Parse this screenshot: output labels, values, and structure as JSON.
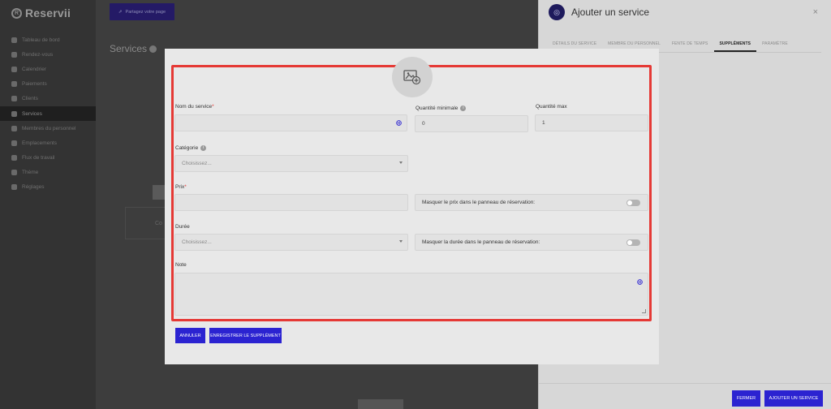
{
  "app": {
    "brand": "Reservii"
  },
  "sidebar": {
    "items": [
      {
        "label": "Tableau de bord",
        "icon": "dashboard-icon"
      },
      {
        "label": "Rendez-vous",
        "icon": "calendar-check-icon"
      },
      {
        "label": "Calendrier",
        "icon": "calendar-icon"
      },
      {
        "label": "Paiements",
        "icon": "payment-icon"
      },
      {
        "label": "Clients",
        "icon": "users-icon"
      },
      {
        "label": "Services",
        "icon": "services-icon",
        "active": true
      },
      {
        "label": "Membres du personnel",
        "icon": "staff-icon"
      },
      {
        "label": "Emplacements",
        "icon": "location-icon"
      },
      {
        "label": "Flux de travail",
        "icon": "workflow-icon"
      },
      {
        "label": "Thème",
        "icon": "brush-icon"
      },
      {
        "label": "Réglages",
        "icon": "gear-icon"
      }
    ]
  },
  "main": {
    "share_label": "Partagez votre page",
    "page_title": "Services",
    "ghost_card": "Co"
  },
  "drawer": {
    "title": "Ajouter un service",
    "close_glyph": "×",
    "tabs": [
      {
        "label": "DÉTAILS DU SERVICE"
      },
      {
        "label": "MEMBRE DU PERSONNEL"
      },
      {
        "label": "FENTE DE TEMPS"
      },
      {
        "label": "SUPPLÉMENTS",
        "active": true
      },
      {
        "label": "PARAMÈTRE"
      }
    ],
    "footer": {
      "close_label": "FERMER",
      "add_label": "AJOUTER UN SERVICE"
    }
  },
  "modal": {
    "image_upload_icon": "image-add-icon",
    "service_name": {
      "label": "Nom du service",
      "required_mark": "*",
      "value": ""
    },
    "min_qty": {
      "label": "Quantité minimale",
      "value": "0"
    },
    "max_qty": {
      "label": "Quantité max",
      "value": "1"
    },
    "category": {
      "label": "Catégorie",
      "placeholder": "Choisissez..."
    },
    "price": {
      "label": "Prix",
      "required_mark": "*",
      "value": ""
    },
    "hide_price": {
      "label": "Masquer le prix dans le panneau de réservation:",
      "on": false
    },
    "duration": {
      "label": "Durée",
      "placeholder": "Choisissez..."
    },
    "hide_duration": {
      "label": "Masquer la durée dans le panneau de réservation:",
      "on": false
    },
    "note": {
      "label": "Note",
      "value": ""
    },
    "cancel_label": "ANNULER",
    "save_label": "ENREGISTRER LE SUPPLÉMENT"
  },
  "colors": {
    "accent": "#2b23d1",
    "highlight": "#e53935"
  }
}
